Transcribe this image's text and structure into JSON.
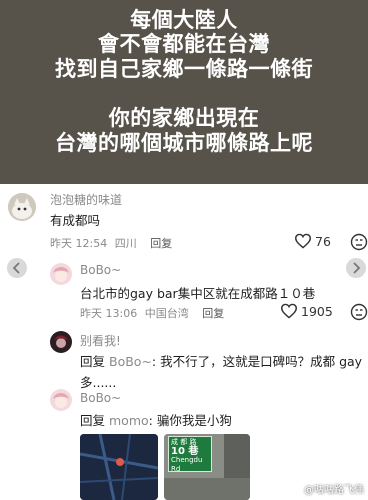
{
  "header": {
    "lines": [
      "每個大陸人",
      "會不會都能在台灣",
      "找到自己家鄉一條路一條街",
      "你的家鄉出現在",
      "台灣的哪個城市哪條路上呢"
    ]
  },
  "comments": [
    {
      "username": "泡泡糖的味道",
      "text": "有成都吗",
      "time": "昨天 12:54",
      "location": "四川",
      "reply_label": "回复",
      "likes": "76"
    },
    {
      "username": "BoBo~",
      "text": "台北市的gay bar集中区就在成都路１０巷",
      "time": "昨天 13:06",
      "location": "中国台湾",
      "reply_label": "回复",
      "likes": "1905"
    },
    {
      "username": "别看我!",
      "reply_prefix": "回复",
      "reply_to": "BoBo~",
      "text_line1": ": 我不行了，这就是口碑吗？成都 gay",
      "text_line2": "多......"
    },
    {
      "username": "BoBo~",
      "reply_prefix": "回复",
      "reply_to": "momo",
      "text": ": 骗你我是小狗"
    }
  ],
  "street_sign": {
    "line1": "成 都 路",
    "line2": "10 巷",
    "line3": "Chengdu Rd"
  },
  "watermark": "@咕咕路飞伟"
}
